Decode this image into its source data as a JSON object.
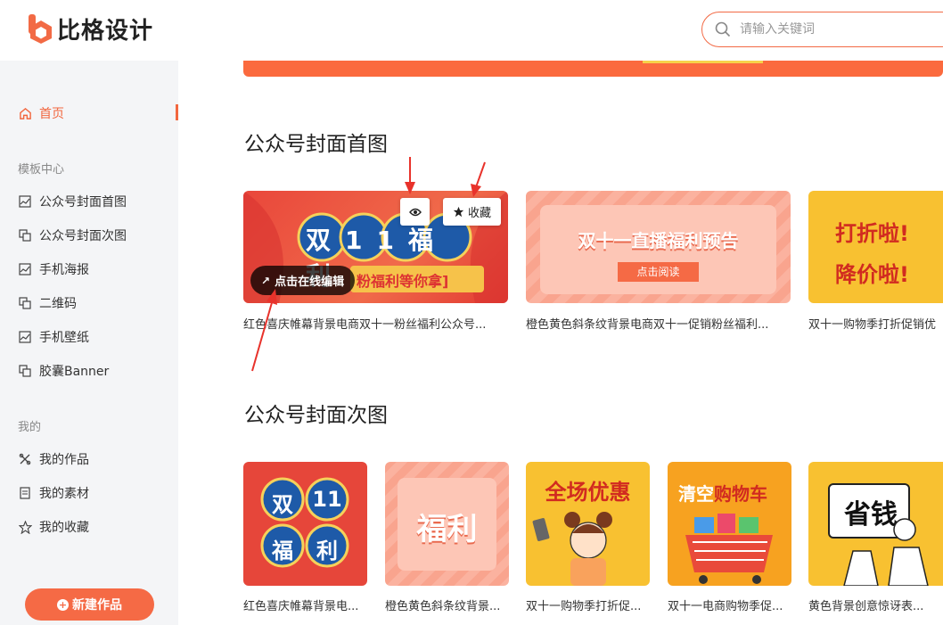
{
  "brand": {
    "name": "比格设计"
  },
  "search": {
    "placeholder": "请输入关键词"
  },
  "sidebar": {
    "home": "首页",
    "templates_title": "模板中心",
    "templates": [
      "公众号封面首图",
      "公众号封面次图",
      "手机海报",
      "二维码",
      "手机壁纸",
      "胶囊Banner"
    ],
    "mine_title": "我的",
    "mine": [
      "我的作品",
      "我的素材",
      "我的收藏"
    ],
    "new_button": "新建作品"
  },
  "section1": {
    "title": "公众号封面首图",
    "cards": [
      {
        "title": "红色喜庆帷幕背景电商双十一粉丝福利公众号...",
        "thumb_big": "双11福利",
        "thumb_sub": "粉福利等你拿]"
      },
      {
        "title": "橙色黄色斜条纹背景电商双十一促销粉丝福利...",
        "thumb_big": "双十一直播福利预告",
        "thumb_sub": "点击阅读"
      },
      {
        "title": "双十一购物季打折促销优",
        "thumb_line1": "打折啦!",
        "thumb_line2": "降价啦!"
      }
    ],
    "hover": {
      "preview_icon": "eye-icon",
      "favorite": "收藏",
      "edit": "点击在线编辑"
    }
  },
  "section2": {
    "title": "公众号封面次图",
    "cards": [
      {
        "title": "红色喜庆帷幕背景电...",
        "thumb_chars": [
          "双",
          "11",
          "福",
          "利"
        ]
      },
      {
        "title": "橙色黄色斜条纹背景...",
        "thumb_text": "福利"
      },
      {
        "title": "双十一购物季打折促...",
        "thumb_text": "全场优惠"
      },
      {
        "title": "双十一电商购物季促...",
        "thumb_text1": "清空",
        "thumb_text2": "购物车"
      },
      {
        "title": "黄色背景创意惊讶表...",
        "thumb_text": "省钱"
      }
    ]
  },
  "colors": {
    "accent": "#f2673f",
    "sidebar_bg": "#f4f5f7",
    "red": "#e5453a",
    "yellow": "#f8c131"
  }
}
